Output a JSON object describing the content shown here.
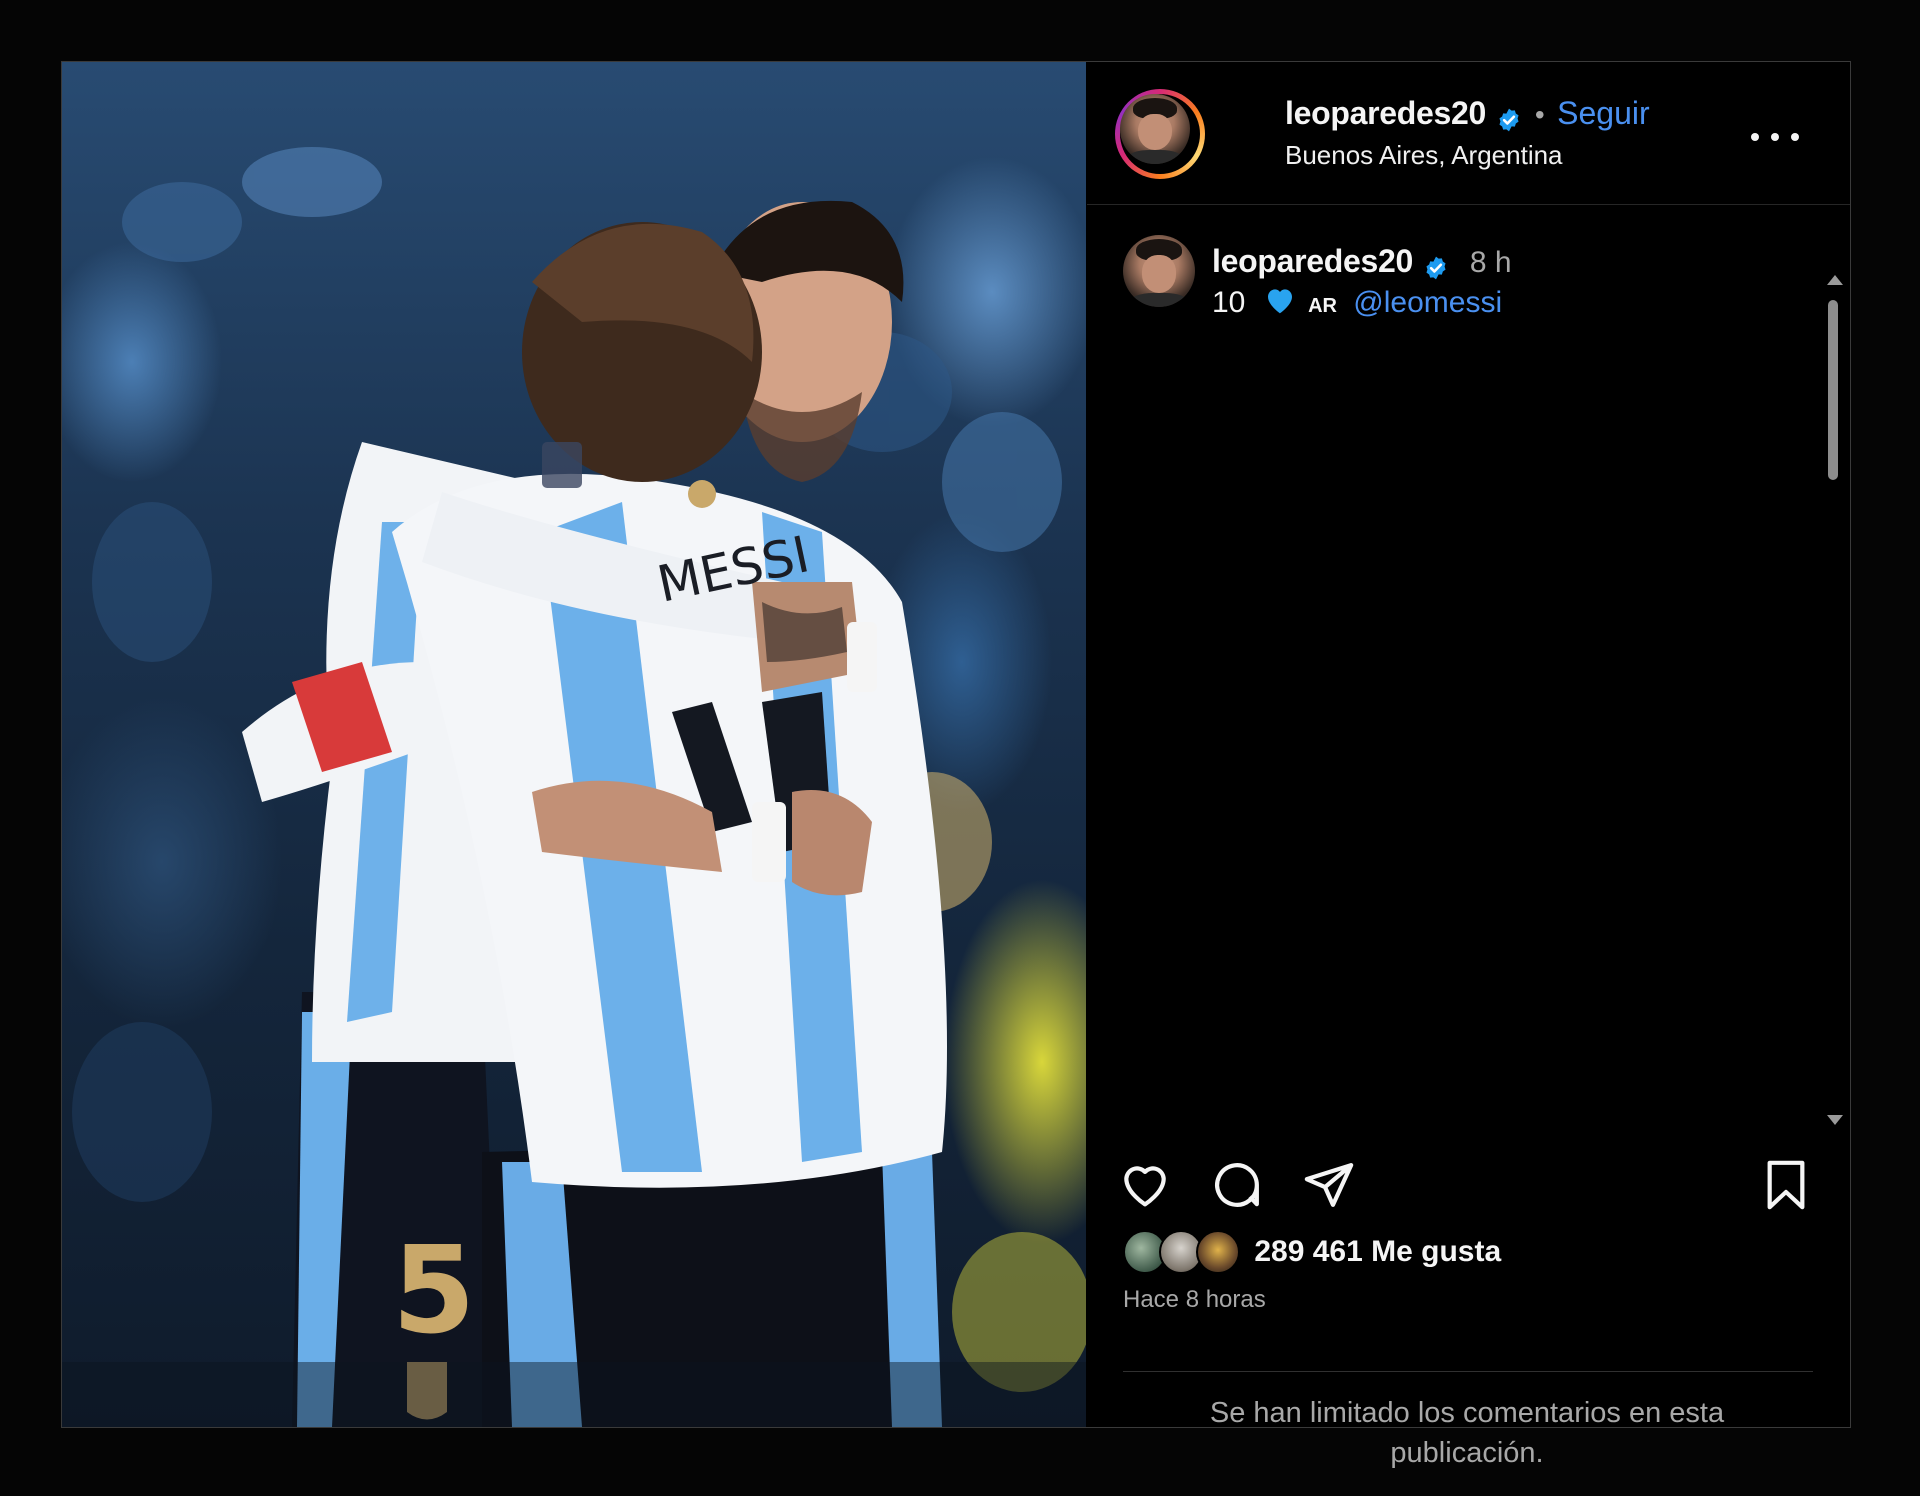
{
  "post": {
    "username": "leoparedes20",
    "verified": true,
    "follow_label": "Seguir",
    "separator": "•",
    "location": "Buenos Aires, Argentina",
    "caption": {
      "username": "leoparedes20",
      "time": "8 h",
      "number": "10",
      "flag_text": "AR",
      "mention": "@leomessi"
    },
    "likes": "289 461 Me gusta",
    "posted_ago": "Hace 8 horas",
    "comments_limited": "Se han limitado los comentarios en esta publicación."
  },
  "photo": {
    "jersey_name": "MESSI",
    "jersey_number": "5"
  },
  "icons": {
    "like": "heart-icon",
    "comment": "comment-icon",
    "share": "share-icon",
    "save": "bookmark-icon",
    "more": "more-options-icon",
    "verified": "verified-badge-icon"
  },
  "colors": {
    "background": "#000000",
    "link": "#4a90f0",
    "verified": "#1d9bf0",
    "muted": "#a8a8a8"
  }
}
